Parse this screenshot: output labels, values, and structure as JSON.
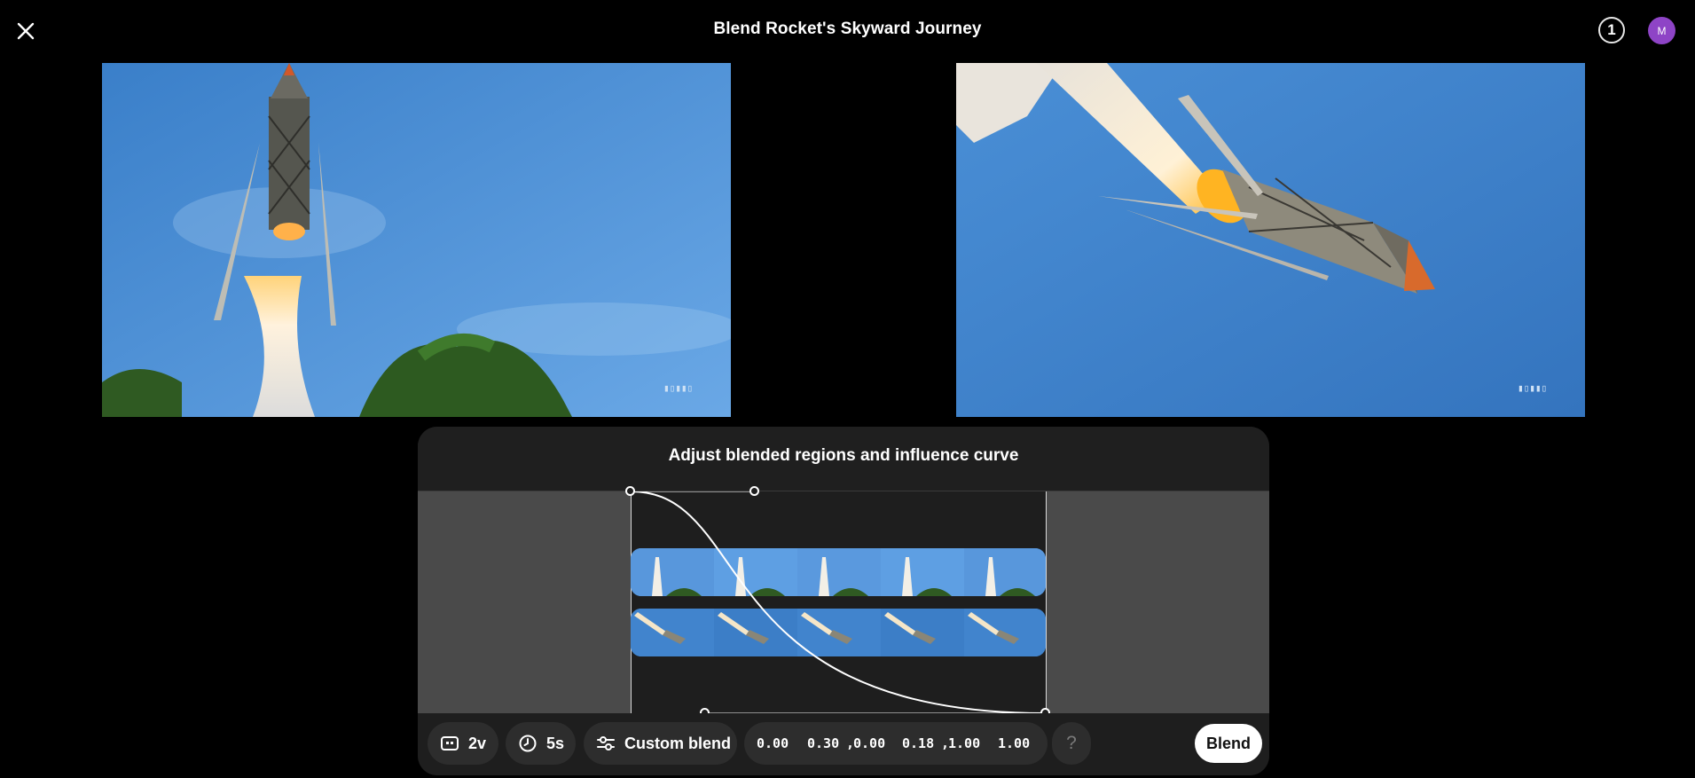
{
  "header": {
    "title": "Blend Rocket's Skyward Journey",
    "credits_count": "1",
    "avatar_initial": "M"
  },
  "icons": {
    "close": "close-icon",
    "frames": "frames-icon",
    "duration": "clock-icon",
    "blend_mode": "sliders-icon",
    "help": "help-icon"
  },
  "videos": [
    {
      "id": "start",
      "description_name": "rocket-launch-ascending"
    },
    {
      "id": "end",
      "description_name": "rocket-flying-diagonal"
    }
  ],
  "panel": {
    "title": "Adjust blended regions and influence curve"
  },
  "controls": {
    "frames_value": "2v",
    "duration_value": "5s",
    "blend_mode_label": "Custom blend",
    "curve_values": [
      {
        "label": "0.00"
      },
      {
        "label": "0.30"
      },
      {
        "label": ","
      },
      {
        "label": "0.00"
      },
      {
        "label": "0.18"
      },
      {
        "label": ","
      },
      {
        "label": "1.00"
      },
      {
        "label": "1.00"
      }
    ],
    "help_label": "?",
    "blend_button_label": "Blend"
  },
  "colors": {
    "background": "#000000",
    "panel": "#1e1e1e",
    "chip": "#2d2d2d",
    "avatar": "#8e44c6",
    "sky": "#3f85cf"
  }
}
